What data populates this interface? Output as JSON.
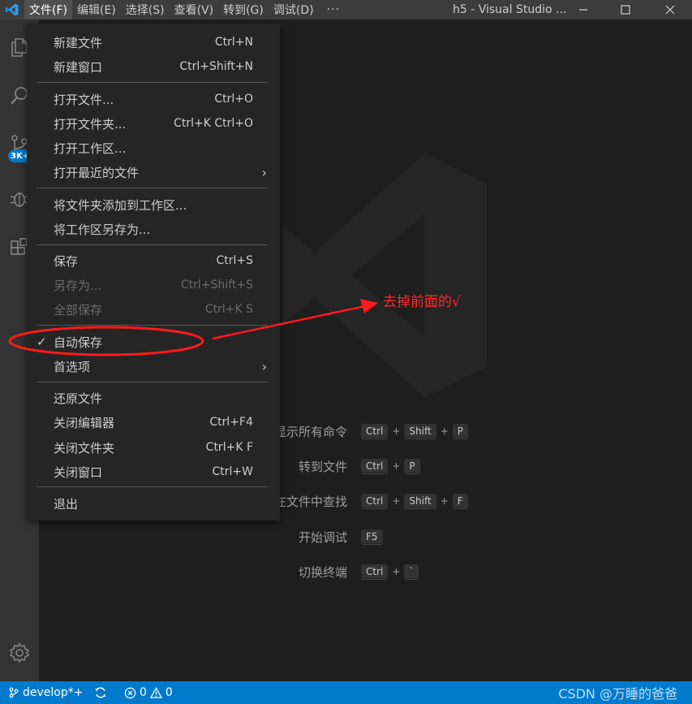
{
  "titlebar": {
    "menus": [
      "文件(F)",
      "编辑(E)",
      "选择(S)",
      "查看(V)",
      "转到(G)",
      "调试(D)"
    ],
    "more": "···",
    "window_title": "h5 - Visual Studio ..."
  },
  "activity": {
    "badge": "3K+"
  },
  "file_menu": {
    "items": [
      {
        "label": "新建文件",
        "shortcut": "Ctrl+N"
      },
      {
        "label": "新建窗口",
        "shortcut": "Ctrl+Shift+N"
      },
      {
        "label": "打开文件...",
        "shortcut": "Ctrl+O"
      },
      {
        "label": "打开文件夹...",
        "shortcut": "Ctrl+K Ctrl+O"
      },
      {
        "label": "打开工作区...",
        "shortcut": ""
      },
      {
        "label": "打开最近的文件",
        "shortcut": ""
      },
      {
        "label": "将文件夹添加到工作区...",
        "shortcut": ""
      },
      {
        "label": "将工作区另存为...",
        "shortcut": ""
      },
      {
        "label": "保存",
        "shortcut": "Ctrl+S"
      },
      {
        "label": "另存为...",
        "shortcut": "Ctrl+Shift+S"
      },
      {
        "label": "全部保存",
        "shortcut": "Ctrl+K S"
      },
      {
        "label": "自动保存",
        "shortcut": "",
        "checked": true
      },
      {
        "label": "首选项",
        "shortcut": ""
      },
      {
        "label": "还原文件",
        "shortcut": ""
      },
      {
        "label": "关闭编辑器",
        "shortcut": "Ctrl+F4"
      },
      {
        "label": "关闭文件夹",
        "shortcut": "Ctrl+K F"
      },
      {
        "label": "关闭窗口",
        "shortcut": "Ctrl+W"
      },
      {
        "label": "退出",
        "shortcut": ""
      }
    ],
    "check_mark": "✓",
    "submenu_arrow": "›"
  },
  "shortcuts": [
    {
      "label": "显示所有命令",
      "keys": [
        "Ctrl",
        "Shift",
        "P"
      ]
    },
    {
      "label": "转到文件",
      "keys": [
        "Ctrl",
        "P"
      ]
    },
    {
      "label": "在文件中查找",
      "keys": [
        "Ctrl",
        "Shift",
        "F"
      ]
    },
    {
      "label": "开始调试",
      "keys": [
        "F5"
      ]
    },
    {
      "label": "切换终端",
      "keys": [
        "Ctrl",
        "`"
      ]
    }
  ],
  "plus_sign": "+",
  "annotation": {
    "text": "去掉前面的√",
    "color": "#ff2a2a"
  },
  "statusbar": {
    "branch": "develop*+",
    "errors": "0",
    "warnings": "0",
    "watermark": "CSDN @万睡的爸爸"
  },
  "colors": {
    "titlebar": "#3c3c3c",
    "activitybar": "#333333",
    "editor": "#1e1e1e",
    "menu": "#252526",
    "statusbar": "#007acc",
    "accent": "#007acc"
  }
}
